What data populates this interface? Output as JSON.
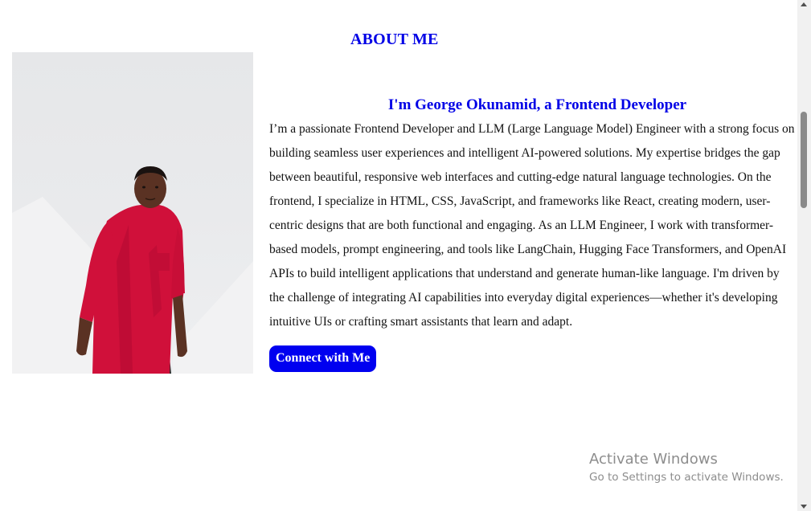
{
  "section": {
    "title": "ABOUT ME"
  },
  "profile": {
    "photo_icon": "person-photo",
    "heading": "I'm George Okunamid, a Frontend Developer",
    "bio": "I’m a passionate Frontend Developer and LLM (Large Language Model) Engineer with a strong focus on building seamless user experiences and intelligent AI-powered solutions. My expertise bridges the gap between beautiful, responsive web interfaces and cutting-edge natural language technologies. On the frontend, I specialize in HTML, CSS, JavaScript, and frameworks like React, creating modern, user-centric designs that are both functional and engaging. As an LLM Engineer, I work with transformer-based models, prompt engineering, and tools like LangChain, Hugging Face Transformers, and OpenAI APIs to build intelligent applications that understand and generate human-like language. I'm driven by the challenge of integrating AI capabilities into everyday digital experiences—whether it's developing intuitive UIs or crafting smart assistants that learn and adapt.",
    "cta_label": "Connect with Me"
  },
  "watermark": {
    "line1": "Activate Windows",
    "line2": "Go to Settings to activate Windows."
  },
  "colors": {
    "accent": "#0000e6",
    "button_bg": "#0000f0",
    "shirt": "#d0103a"
  }
}
